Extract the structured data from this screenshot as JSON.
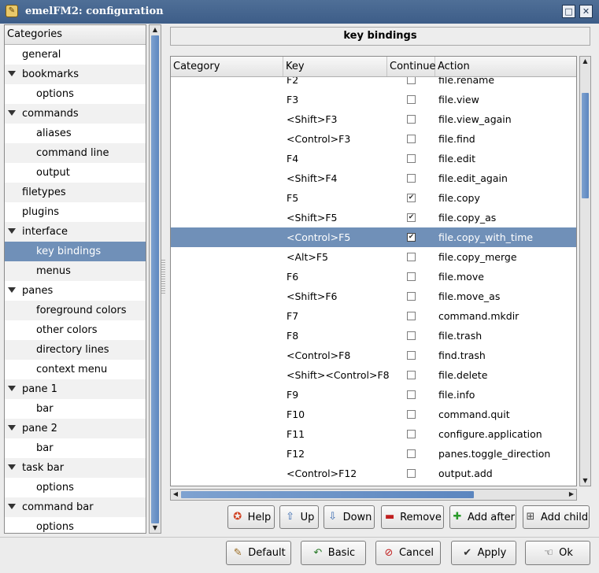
{
  "window": {
    "title": "emelFM2: configuration",
    "icon": "file-manager-icon",
    "maximize_glyph": "□",
    "close_glyph": "✕"
  },
  "categories": {
    "header": "Categories",
    "items": [
      {
        "label": "general",
        "level": 0,
        "expander": false
      },
      {
        "label": "bookmarks",
        "level": 0,
        "expander": true
      },
      {
        "label": "options",
        "level": 1,
        "expander": false
      },
      {
        "label": "commands",
        "level": 0,
        "expander": true
      },
      {
        "label": "aliases",
        "level": 1,
        "expander": false
      },
      {
        "label": "command line",
        "level": 1,
        "expander": false
      },
      {
        "label": "output",
        "level": 1,
        "expander": false
      },
      {
        "label": "filetypes",
        "level": 0,
        "expander": false
      },
      {
        "label": "plugins",
        "level": 0,
        "expander": false
      },
      {
        "label": "interface",
        "level": 0,
        "expander": true
      },
      {
        "label": "key bindings",
        "level": 1,
        "expander": false,
        "selected": true
      },
      {
        "label": "menus",
        "level": 1,
        "expander": false
      },
      {
        "label": "panes",
        "level": 0,
        "expander": true
      },
      {
        "label": "foreground colors",
        "level": 1,
        "expander": false
      },
      {
        "label": "other colors",
        "level": 1,
        "expander": false
      },
      {
        "label": "directory lines",
        "level": 1,
        "expander": false
      },
      {
        "label": "context menu",
        "level": 1,
        "expander": false
      },
      {
        "label": "pane 1",
        "level": 0,
        "expander": true
      },
      {
        "label": "bar",
        "level": 1,
        "expander": false
      },
      {
        "label": "pane 2",
        "level": 0,
        "expander": true
      },
      {
        "label": "bar",
        "level": 1,
        "expander": false
      },
      {
        "label": "task bar",
        "level": 0,
        "expander": true
      },
      {
        "label": "options",
        "level": 1,
        "expander": false
      },
      {
        "label": "command bar",
        "level": 0,
        "expander": true
      },
      {
        "label": "options",
        "level": 1,
        "expander": false
      }
    ]
  },
  "page_title": "key bindings",
  "table": {
    "columns": [
      "Category",
      "Key",
      "Continue",
      "Action"
    ],
    "rows": [
      {
        "key": "F2",
        "continue": false,
        "action": "file.rename"
      },
      {
        "key": "F3",
        "continue": false,
        "action": "file.view"
      },
      {
        "key": "<Shift>F3",
        "continue": false,
        "action": "file.view_again"
      },
      {
        "key": "<Control>F3",
        "continue": false,
        "action": "file.find"
      },
      {
        "key": "F4",
        "continue": false,
        "action": "file.edit"
      },
      {
        "key": "<Shift>F4",
        "continue": false,
        "action": "file.edit_again"
      },
      {
        "key": "F5",
        "continue": true,
        "action": "file.copy"
      },
      {
        "key": "<Shift>F5",
        "continue": true,
        "action": "file.copy_as"
      },
      {
        "key": "<Control>F5",
        "continue": true,
        "action": "file.copy_with_time",
        "selected": true
      },
      {
        "key": "<Alt>F5",
        "continue": false,
        "action": "file.copy_merge"
      },
      {
        "key": "F6",
        "continue": false,
        "action": "file.move"
      },
      {
        "key": "<Shift>F6",
        "continue": false,
        "action": "file.move_as"
      },
      {
        "key": "F7",
        "continue": false,
        "action": "command.mkdir"
      },
      {
        "key": "F8",
        "continue": false,
        "action": "file.trash"
      },
      {
        "key": "<Control>F8",
        "continue": false,
        "action": "find.trash"
      },
      {
        "key": "<Shift><Control>F8",
        "continue": false,
        "action": "file.delete"
      },
      {
        "key": "F9",
        "continue": false,
        "action": "file.info"
      },
      {
        "key": "F10",
        "continue": false,
        "action": "command.quit"
      },
      {
        "key": "F11",
        "continue": false,
        "action": "configure.application"
      },
      {
        "key": "F12",
        "continue": false,
        "action": "panes.toggle_direction"
      },
      {
        "key": "<Control>F12",
        "continue": false,
        "action": "output.add"
      }
    ]
  },
  "scroll": {
    "arrow_up": "▲",
    "arrow_down": "▼",
    "arrow_left": "◀",
    "arrow_right": "▶"
  },
  "action_buttons": [
    {
      "id": "help",
      "label": "Help",
      "icon": "help-lifebuoy-icon",
      "glyph": "✪",
      "color": "#d04020"
    },
    {
      "id": "up",
      "label": "Up",
      "icon": "arrow-up-icon",
      "glyph": "⇧",
      "color": "#3a6ab0"
    },
    {
      "id": "down",
      "label": "Down",
      "icon": "arrow-down-icon",
      "glyph": "⇩",
      "color": "#3a6ab0"
    },
    {
      "id": "remove",
      "label": "Remove",
      "icon": "minus-icon",
      "glyph": "▬",
      "color": "#c02020"
    },
    {
      "id": "add-after",
      "label": "Add after",
      "icon": "plus-icon",
      "glyph": "✚",
      "color": "#2a9a2a"
    },
    {
      "id": "add-child",
      "label": "Add child",
      "icon": "add-child-icon",
      "glyph": "⊞",
      "color": "#444444"
    }
  ],
  "dialog_buttons": [
    {
      "id": "default",
      "label": "Default",
      "icon": "broom-icon",
      "glyph": "✎",
      "color": "#9a6a20"
    },
    {
      "id": "basic",
      "label": "Basic",
      "icon": "undo-icon",
      "glyph": "↶",
      "color": "#2a7a2a"
    },
    {
      "id": "cancel",
      "label": "Cancel",
      "icon": "cancel-icon",
      "glyph": "⊘",
      "color": "#c02020"
    },
    {
      "id": "apply",
      "label": "Apply",
      "icon": "checkmark-icon",
      "glyph": "✔",
      "color": "#333333"
    },
    {
      "id": "ok",
      "label": "Ok",
      "icon": "ok-hand-icon",
      "glyph": "☜",
      "color": "#333333"
    }
  ],
  "colors": {
    "selection": "#7090b8",
    "titlebar": "#46668f",
    "scroll_thumb": "#6a92c8"
  }
}
